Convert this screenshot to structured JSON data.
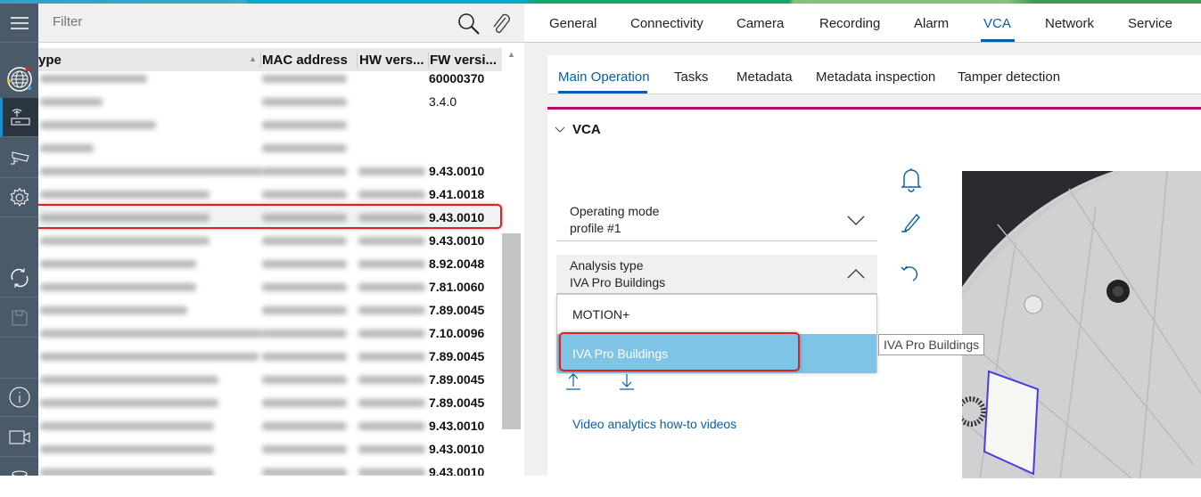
{
  "filter": {
    "placeholder": "Filter"
  },
  "table": {
    "columns": [
      "ype",
      "MAC address",
      "HW vers...",
      "FW versi..."
    ],
    "rows": [
      {
        "fw": "60000370",
        "bold": true
      },
      {
        "fw": "3.4.0",
        "bold": false
      },
      {
        "fw": "",
        "bold": false
      },
      {
        "fw": "",
        "bold": false
      },
      {
        "fw": "9.43.0010",
        "bold": true
      },
      {
        "fw": "9.41.0018",
        "bold": true
      },
      {
        "fw": "9.43.0010",
        "bold": true,
        "selected": true
      },
      {
        "fw": "9.43.0010",
        "bold": true
      },
      {
        "fw": "8.92.0048",
        "bold": true
      },
      {
        "fw": "7.81.0060",
        "bold": true
      },
      {
        "fw": "7.89.0045",
        "bold": true
      },
      {
        "fw": "7.10.0096",
        "bold": true
      },
      {
        "fw": "7.89.0045",
        "bold": true
      },
      {
        "fw": "7.89.0045",
        "bold": true
      },
      {
        "fw": "7.89.0045",
        "bold": true
      },
      {
        "fw": "9.43.0010",
        "bold": true
      },
      {
        "fw": "9.43.0010",
        "bold": true
      },
      {
        "fw": "9.43.0010",
        "bold": true
      }
    ]
  },
  "main_tabs": [
    "General",
    "Connectivity",
    "Camera",
    "Recording",
    "Alarm",
    "VCA",
    "Network",
    "Service"
  ],
  "active_main_tab": "VCA",
  "sub_tabs": [
    "Main Operation",
    "Tasks",
    "Metadata",
    "Metadata inspection",
    "Tamper detection"
  ],
  "active_sub_tab": "Main Operation",
  "section": {
    "title": "VCA"
  },
  "operating_mode": {
    "label": "Operating mode",
    "value": "profile #1"
  },
  "analysis_type": {
    "label": "Analysis type",
    "value": "IVA Pro Buildings",
    "options": [
      "MOTION+",
      "IVA Pro Buildings"
    ],
    "highlighted": "IVA Pro Buildings"
  },
  "tooltip": "IVA Pro Buildings",
  "link": "Video analytics how-to videos",
  "colors": {
    "accent": "#0a5ea8",
    "magenta": "#b0106c",
    "highlight": "#7fc4e6",
    "sidebar": "#4b5a68",
    "annotation": "#e02020"
  }
}
